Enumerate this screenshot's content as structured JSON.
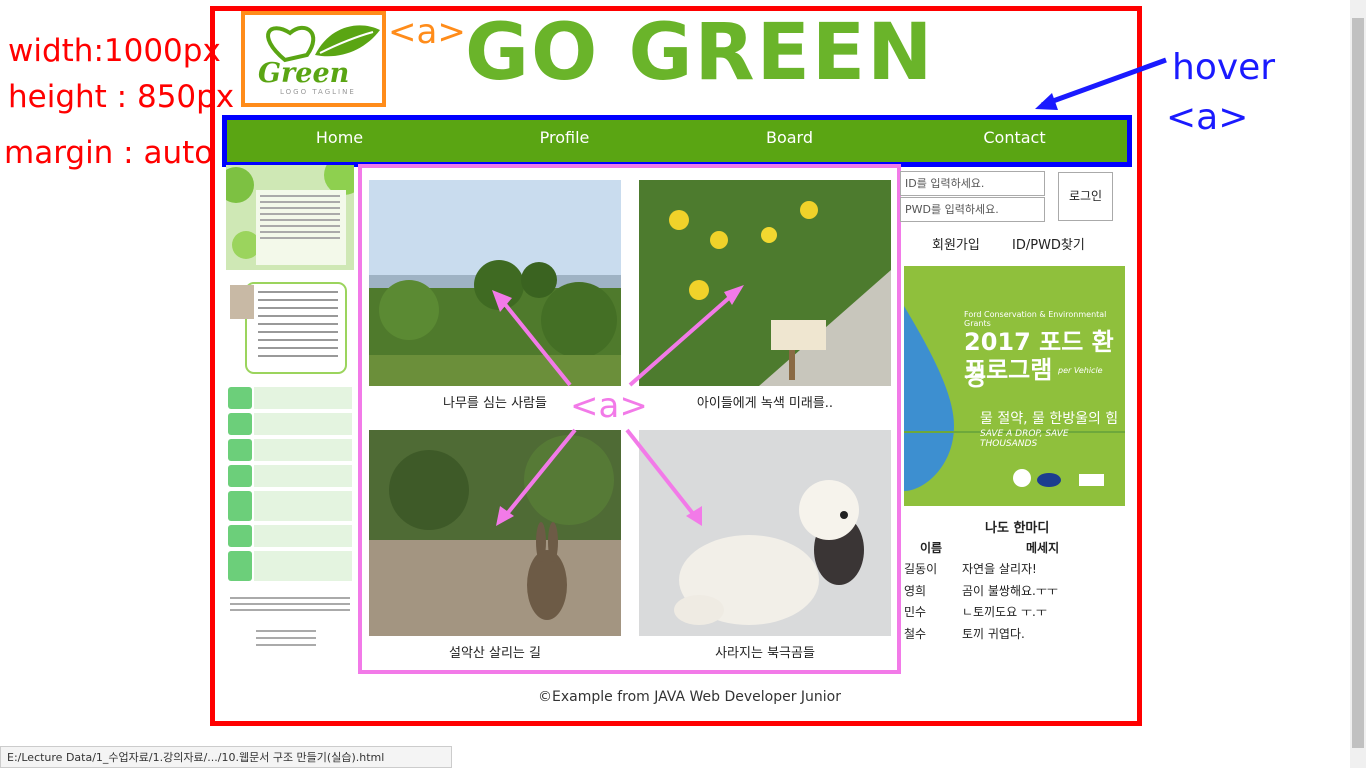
{
  "annotations": {
    "width": "width:1000px",
    "height": "height : 850px",
    "margin": "margin : auto",
    "hover": "hover",
    "nav_a": "<a>",
    "logo_a": "<a>",
    "gallery_a": "<a>"
  },
  "header": {
    "logo_word": "Green",
    "logo_tagline": "LOGO TAGLINE",
    "brand": "GO GREEN"
  },
  "nav": {
    "items": [
      {
        "label": "Home"
      },
      {
        "label": "Profile"
      },
      {
        "label": "Board"
      },
      {
        "label": "Contact"
      }
    ]
  },
  "gallery": {
    "items": [
      {
        "caption": "나무를 심는 사람들",
        "icon": "river-forest-photo"
      },
      {
        "caption": "아이들에게 녹색 미래를..",
        "icon": "flowers-sign-photo"
      },
      {
        "caption": "설악산 살리는 길",
        "icon": "rabbit-photo"
      },
      {
        "caption": "사라지는 북극곰들",
        "icon": "polar-bear-photo"
      }
    ]
  },
  "login": {
    "id_placeholder": "ID를 입력하세요.",
    "pw_placeholder": "PWD를 입력하세요.",
    "button": "로그인",
    "signup": "회원가입",
    "find": "ID/PWD찾기"
  },
  "ad": {
    "line1": "Ford Conservation & Environmental Grants",
    "title1": "2017 포드 환경",
    "title2": "프로그램",
    "slogan": "물 절약, 물 한방울의 힘",
    "sub": "SAVE A DROP, SAVE THOUSANDS",
    "per": "per Vehicle"
  },
  "guestbook": {
    "title": "나도 한마디",
    "col_name": "이름",
    "col_msg": "메세지",
    "rows": [
      {
        "name": "길동이",
        "msg": "자연을 살리자!"
      },
      {
        "name": "영희",
        "msg": "곰이 불쌍해요.ㅜㅜ"
      },
      {
        "name": "민수",
        "msg": "ㄴ토끼도요 ㅜ.ㅜ"
      },
      {
        "name": "철수",
        "msg": "토끼 귀엽다."
      }
    ]
  },
  "footer": {
    "text": "©Example from JAVA Web Developer Junior"
  },
  "statusbar": {
    "url": "E:/Lecture Data/1_수업자료/1.강의자료/.../10.웹문서 구조 만들기(실습).html"
  },
  "colors": {
    "nav_bg": "#5aa513",
    "brand": "#6ab42a",
    "frame_red": "#ff0000",
    "frame_blue": "#0000ff",
    "frame_orange": "#ff8c1a",
    "frame_pink": "#f27ae8"
  }
}
